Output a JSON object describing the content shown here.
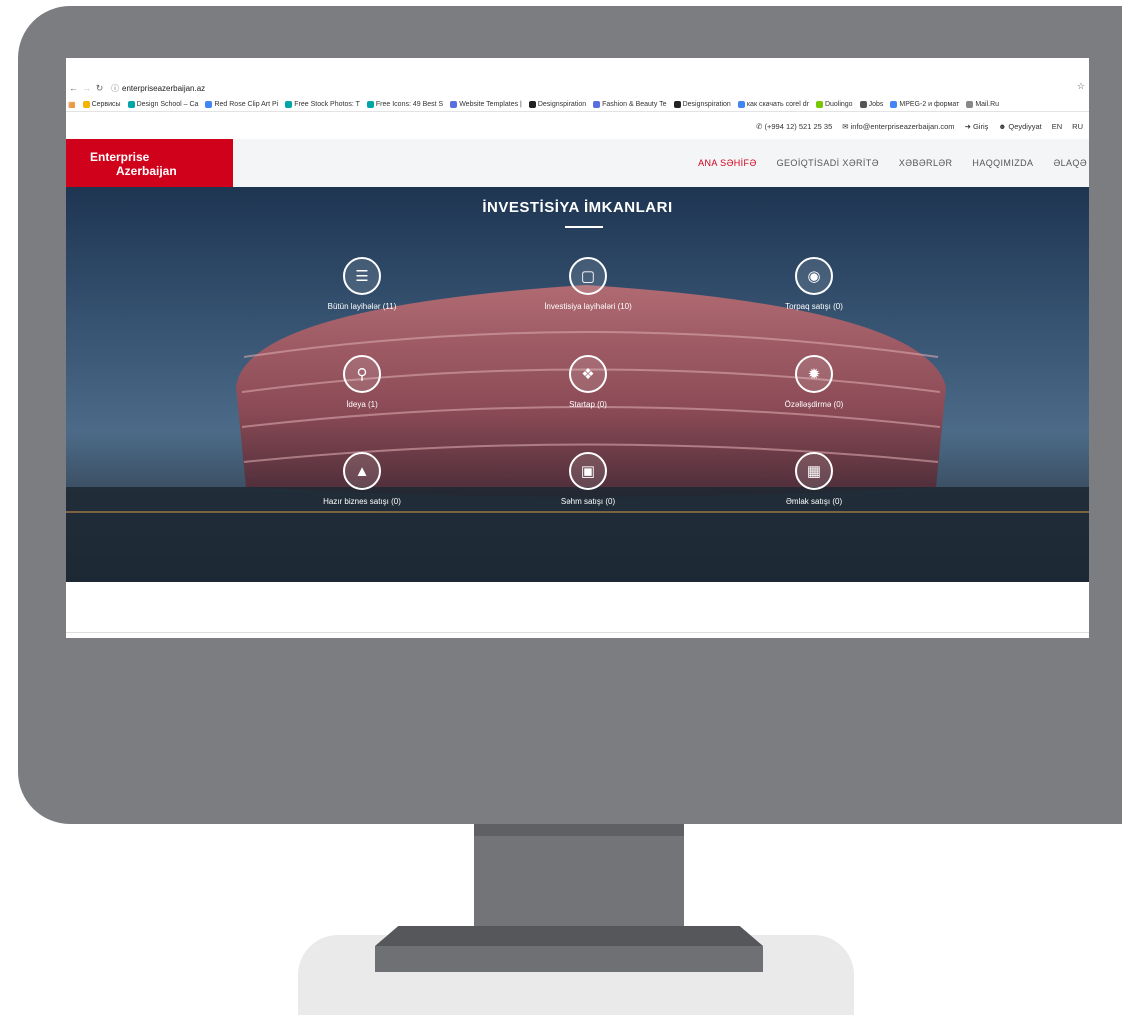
{
  "browser": {
    "url": "enterpriseazerbaijan.az",
    "bookmarks": [
      {
        "label": "Сервисы",
        "color": "#f4b400"
      },
      {
        "label": "Design School – Ca",
        "color": "#00a6a6"
      },
      {
        "label": "Red Rose Clip Art Pi",
        "color": "#4285f4"
      },
      {
        "label": "Free Stock Photos: T",
        "color": "#00a6a6"
      },
      {
        "label": "Free Icons: 49 Best S",
        "color": "#00a6a6"
      },
      {
        "label": "Website Templates |",
        "color": "#5b6ee1"
      },
      {
        "label": "Designspiration",
        "color": "#222222"
      },
      {
        "label": "Fashion & Beauty Te",
        "color": "#5b6ee1"
      },
      {
        "label": "Designspiration",
        "color": "#222222"
      },
      {
        "label": "как скачать corel dr",
        "color": "#4285f4"
      },
      {
        "label": "Duolingo",
        "color": "#78c800"
      },
      {
        "label": "Jobs",
        "color": "#555555"
      },
      {
        "label": "MPEG-2 и формат",
        "color": "#4285f4"
      },
      {
        "label": "Mail.Ru",
        "color": "#888888"
      }
    ]
  },
  "topinfo": {
    "phone": "(+994 12) 521 25 35",
    "email": "info@enterpriseazerbaijan.com",
    "login": "Giriş",
    "register": "Qeydiyyat",
    "lang_en": "EN",
    "lang_ru": "RU"
  },
  "logo": {
    "line1": "Enterprise",
    "line2": "Azerbaijan"
  },
  "nav": [
    "ANA SƏHİFƏ",
    "GEOİQTİSADİ XƏRİTƏ",
    "XƏBƏRLƏR",
    "HAQQIMIZDA",
    "ƏLAQƏ"
  ],
  "hero": {
    "title": "İNVESTİSİYA İMKANLARI",
    "items": [
      {
        "label": "Bütün layihələr (11)",
        "icon": "database-icon"
      },
      {
        "label": "İnvestisiya layihələri (10)",
        "icon": "credit-card-icon"
      },
      {
        "label": "Torpaq satışı (0)",
        "icon": "globe-icon"
      },
      {
        "label": "İdeya (1)",
        "icon": "lightbulb-icon"
      },
      {
        "label": "Startap (0)",
        "icon": "tag-icon"
      },
      {
        "label": "Özəlləşdirmə (0)",
        "icon": "gear-badge-icon"
      },
      {
        "label": "Hazır biznes satışı (0)",
        "icon": "graduation-cap-icon"
      },
      {
        "label": "Səhm satışı (0)",
        "icon": "money-icon"
      },
      {
        "label": "Əmlak satışı (0)",
        "icon": "building-icon"
      }
    ]
  }
}
